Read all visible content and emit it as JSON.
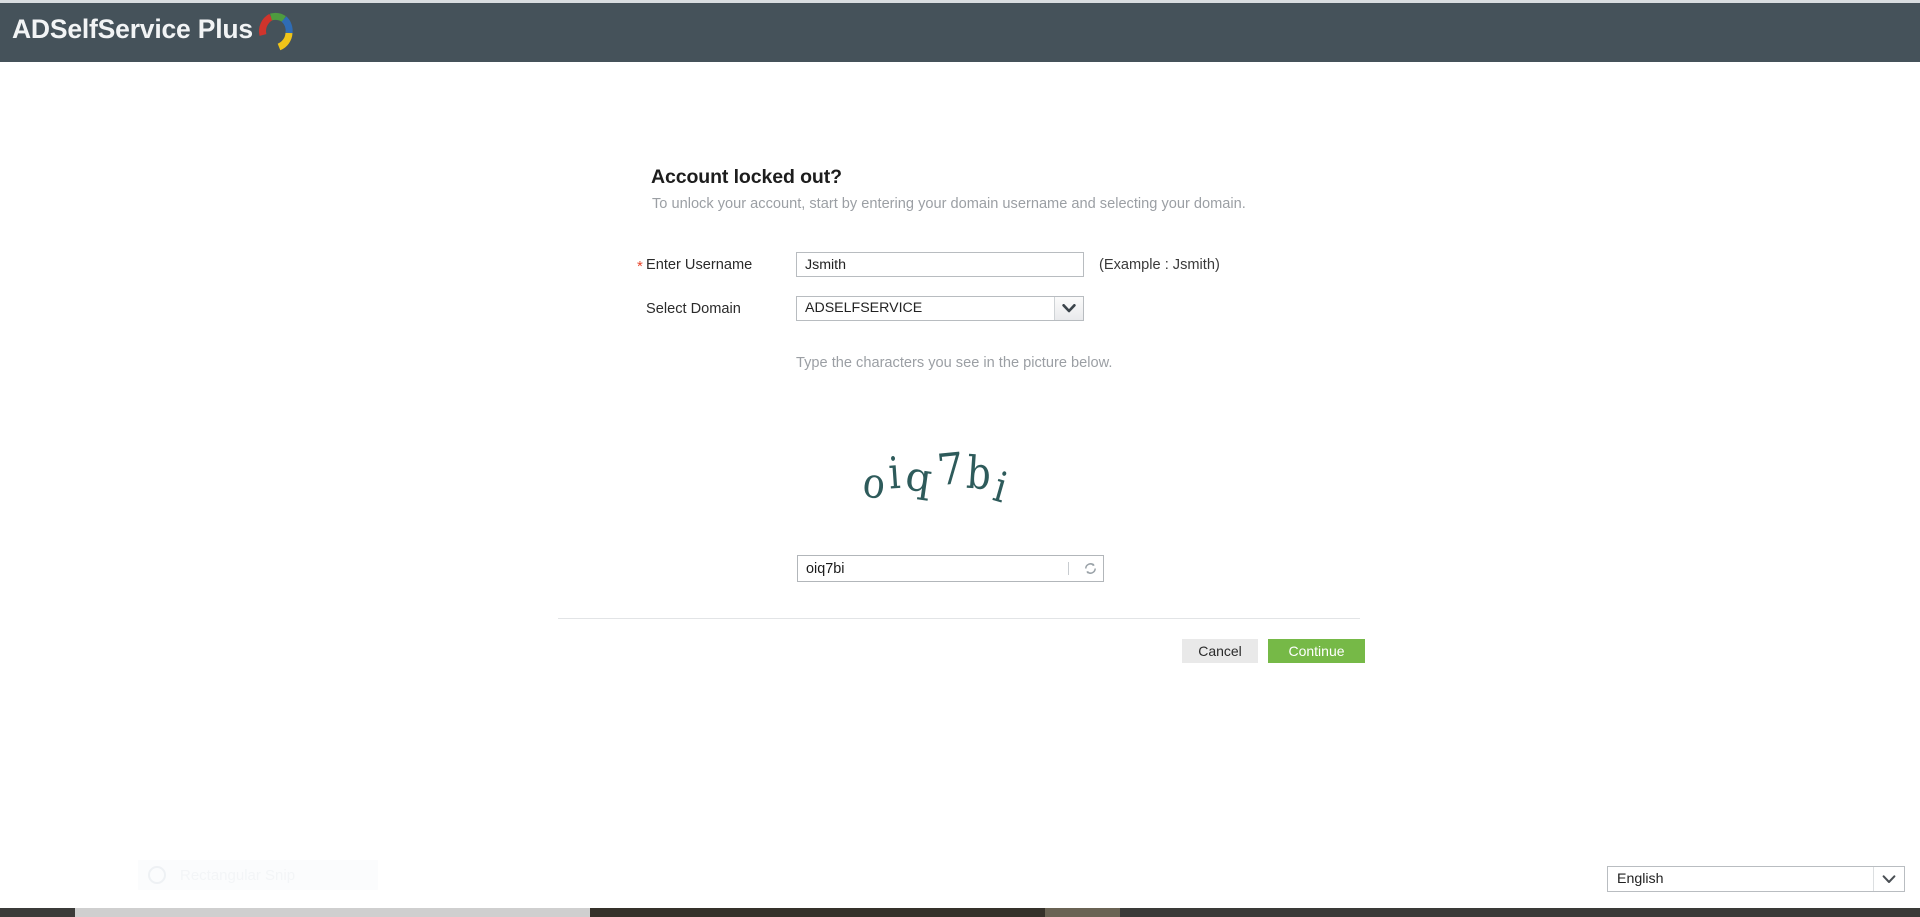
{
  "header": {
    "product_name": "ADSelfService Plus",
    "background_color": "#45525a",
    "logo_arc_colors": [
      "#d0342c",
      "#4e9b3f",
      "#2f6cb5",
      "#f0c419"
    ]
  },
  "page": {
    "title": "Account locked out?",
    "subtitle": "To unlock your account, start by entering your domain username and selecting your domain."
  },
  "form": {
    "username": {
      "label": "Enter Username",
      "required_marker": "*",
      "value": "Jsmith",
      "placeholder": "",
      "hint": "(Example : Jsmith)"
    },
    "domain": {
      "label": "Select Domain",
      "selected": "ADSELFSERVICE",
      "options": [
        "ADSELFSERVICE"
      ],
      "arrow_icon": "chevron-down-icon"
    }
  },
  "captcha": {
    "instruction": "Type the characters you see in the picture below.",
    "image_text": "oiq7bi",
    "image_color": "#2e5b5b",
    "input_value": "oiq7bi",
    "input_placeholder": "",
    "refresh_icon": "refresh-icon"
  },
  "actions": {
    "cancel_label": "Cancel",
    "continue_label": "Continue",
    "continue_color": "#76b947",
    "cancel_color": "#e9e9e9"
  },
  "language": {
    "selected": "English",
    "options": [
      "English"
    ],
    "arrow_icon": "chevron-down-icon"
  },
  "overlay": {
    "snip_label": "Rectangular Snip",
    "snip_icon": "camera-icon"
  }
}
